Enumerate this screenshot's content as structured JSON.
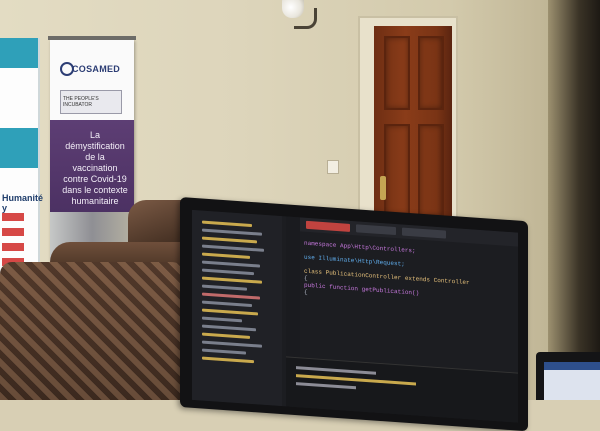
{
  "photo": {
    "subject": "office room with sofa, door, information banner and computer monitor showing a code editor"
  },
  "banner": {
    "org": "COSAMED",
    "sub_org": "THE PEOPLE'S INCUBATOR",
    "message": "La démystification de la vaccination contre Covid-19 dans le contexte humanitaire"
  },
  "banner_left": {
    "visible_text": "Humanité y"
  },
  "monitor_code": {
    "lines": [
      "namespace App\\Http\\Controllers;",
      "",
      "use Illuminate\\Http\\Request;",
      "",
      "class PublicationController extends Controller",
      "{",
      "    public function getPublication()",
      "    {"
    ]
  },
  "colors": {
    "wall": "#ddd5bb",
    "door": "#8a3c19",
    "banner_purple": "#5d3e74",
    "editor_bg": "#1c1d21",
    "keyword": "#c678dd",
    "class_name": "#e5c07b",
    "string": "#98c379"
  }
}
